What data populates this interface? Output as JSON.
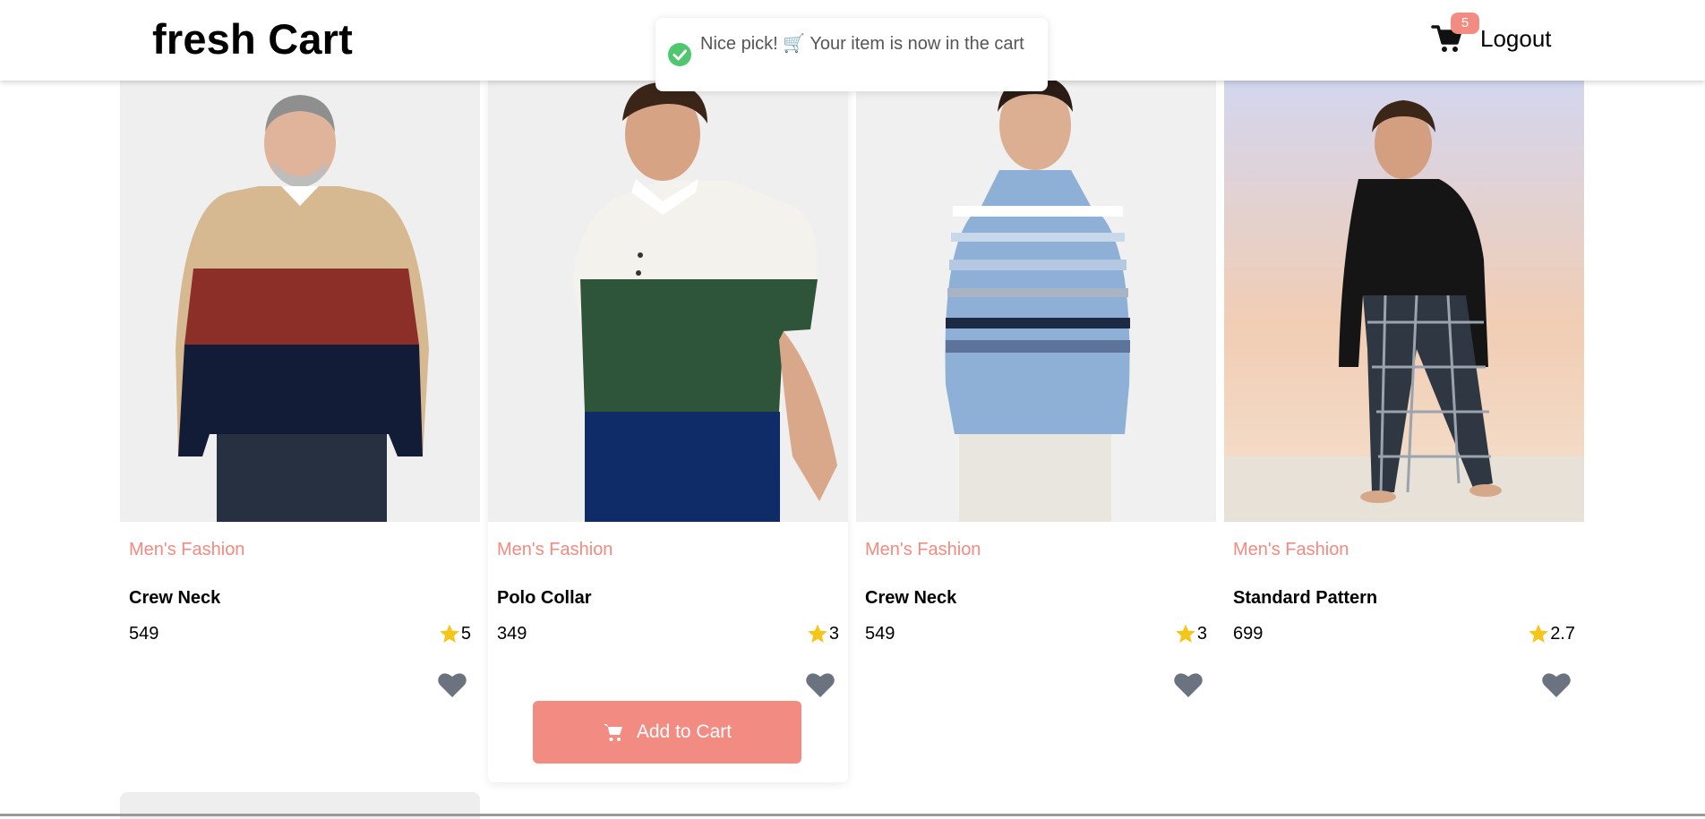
{
  "header": {
    "brand": "fresh Cart",
    "cart_count": "5",
    "logout_label": "Logout"
  },
  "toast": {
    "message": "Nice pick! 🛒 Your item is now in the cart"
  },
  "products": [
    {
      "category": "Men's Fashion",
      "title": "Crew Neck",
      "price": "549",
      "rating": "5"
    },
    {
      "category": "Men's Fashion",
      "title": "Polo Collar",
      "price": "349",
      "rating": "3"
    },
    {
      "category": "Men's Fashion",
      "title": "Crew Neck",
      "price": "549",
      "rating": "3"
    },
    {
      "category": "Men's Fashion",
      "title": "Standard Pattern",
      "price": "699",
      "rating": "2.7"
    }
  ],
  "add_to_cart_label": "Add to Cart",
  "colors": {
    "accent": "#f28b82",
    "star": "#f5c518",
    "heart": "#6b7280",
    "toast_success": "#4ec76e"
  }
}
